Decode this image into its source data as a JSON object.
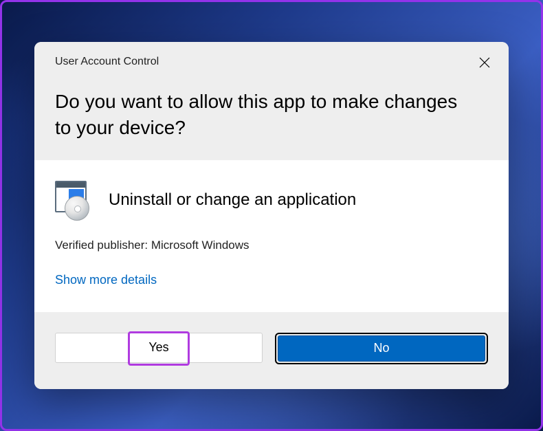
{
  "dialog": {
    "title": "User Account Control",
    "question": "Do you want to allow this app to make changes to your device?",
    "app_name": "Uninstall or change an application",
    "publisher_line": "Verified publisher: Microsoft Windows",
    "details_link": "Show more details",
    "buttons": {
      "yes": "Yes",
      "no": "No"
    }
  },
  "colors": {
    "accent": "#0067c0",
    "highlight_purple": "#b03be0"
  }
}
